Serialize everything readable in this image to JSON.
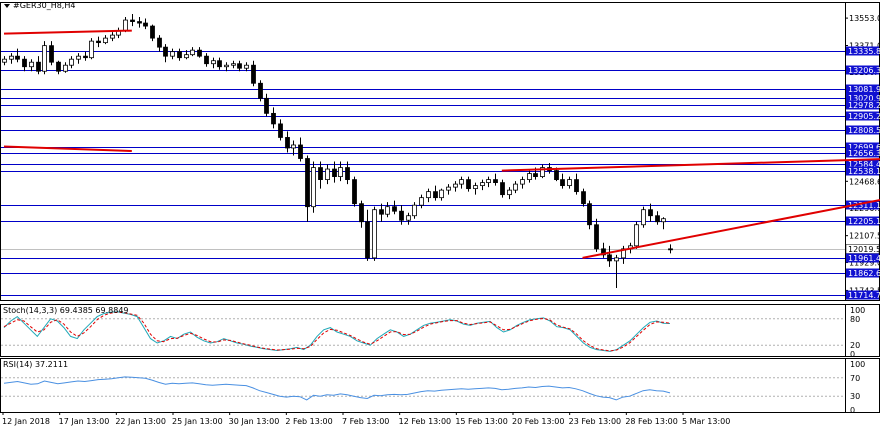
{
  "chart_title": "#GER30_H8,H4",
  "colors": {
    "level_line": "#0000c8",
    "trend_line": "#e00000",
    "label_bg": "#1010d0",
    "stoch_main": "#1fa8b8",
    "stoch_signal": "#e00000",
    "rsi": "#4a90e2"
  },
  "price_axis": {
    "ticks": [
      "13553.0",
      "13371.0",
      "13196.4",
      "12971.2",
      "12809.7",
      "12647.2",
      "12468.6",
      "12290.1",
      "12107.5",
      "11929.0",
      "11743.5"
    ],
    "range": [
      11680,
      13660
    ]
  },
  "levels": [
    "13335.8",
    "13206.3",
    "13081.9",
    "13020.9",
    "12978.2",
    "12905.2",
    "12808.5",
    "12699.6",
    "12656.3",
    "12584.4",
    "12538.1",
    "12311.1",
    "12205.1",
    "12019.5",
    "11961.4",
    "11862.6",
    "11714.7"
  ],
  "current_price": "12019.5",
  "chart_data": {
    "type": "candlestick",
    "x_labels": [
      "12 Jan 2018",
      "17 Jan 13:00",
      "22 Jan 13:00",
      "25 Jan 13:00",
      "30 Jan 13:00",
      "2 Feb 13:00",
      "7 Feb 13:00",
      "12 Feb 13:00",
      "15 Feb 13:00",
      "20 Feb 13:00",
      "23 Feb 13:00",
      "28 Feb 13:00",
      "5 Mar 13:00"
    ],
    "ohlc": [
      [
        13260,
        13300,
        13240,
        13280
      ],
      [
        13280,
        13320,
        13250,
        13300
      ],
      [
        13300,
        13350,
        13260,
        13280
      ],
      [
        13280,
        13300,
        13200,
        13230
      ],
      [
        13230,
        13280,
        13200,
        13260
      ],
      [
        13260,
        13300,
        13180,
        13200
      ],
      [
        13200,
        13400,
        13180,
        13370
      ],
      [
        13370,
        13400,
        13240,
        13260
      ],
      [
        13260,
        13270,
        13180,
        13200
      ],
      [
        13200,
        13260,
        13190,
        13240
      ],
      [
        13240,
        13300,
        13220,
        13280
      ],
      [
        13280,
        13320,
        13250,
        13300
      ],
      [
        13300,
        13330,
        13270,
        13290
      ],
      [
        13290,
        13420,
        13280,
        13400
      ],
      [
        13400,
        13430,
        13360,
        13390
      ],
      [
        13390,
        13440,
        13380,
        13420
      ],
      [
        13420,
        13460,
        13400,
        13440
      ],
      [
        13440,
        13490,
        13420,
        13470
      ],
      [
        13470,
        13560,
        13460,
        13540
      ],
      [
        13540,
        13580,
        13500,
        13530
      ],
      [
        13530,
        13560,
        13490,
        13520
      ],
      [
        13520,
        13550,
        13480,
        13500
      ],
      [
        13500,
        13510,
        13400,
        13420
      ],
      [
        13420,
        13440,
        13330,
        13360
      ],
      [
        13360,
        13380,
        13260,
        13300
      ],
      [
        13300,
        13350,
        13280,
        13330
      ],
      [
        13330,
        13350,
        13270,
        13290
      ],
      [
        13290,
        13340,
        13280,
        13310
      ],
      [
        13310,
        13360,
        13300,
        13340
      ],
      [
        13340,
        13360,
        13290,
        13300
      ],
      [
        13300,
        13320,
        13230,
        13250
      ],
      [
        13250,
        13290,
        13220,
        13270
      ],
      [
        13270,
        13290,
        13210,
        13230
      ],
      [
        13230,
        13260,
        13200,
        13240
      ],
      [
        13240,
        13270,
        13220,
        13250
      ],
      [
        13250,
        13270,
        13200,
        13220
      ],
      [
        13220,
        13260,
        13200,
        13240
      ],
      [
        13240,
        13270,
        13100,
        13120
      ],
      [
        13120,
        13140,
        13000,
        13020
      ],
      [
        13020,
        13050,
        12900,
        12920
      ],
      [
        12920,
        12960,
        12820,
        12850
      ],
      [
        12850,
        12880,
        12740,
        12760
      ],
      [
        12760,
        12800,
        12660,
        12690
      ],
      [
        12690,
        12740,
        12640,
        12710
      ],
      [
        12710,
        12760,
        12600,
        12620
      ],
      [
        12620,
        12640,
        12200,
        12300
      ],
      [
        12300,
        12600,
        12260,
        12560
      ],
      [
        12560,
        12600,
        12420,
        12480
      ],
      [
        12480,
        12580,
        12450,
        12550
      ],
      [
        12550,
        12600,
        12460,
        12500
      ],
      [
        12500,
        12600,
        12470,
        12560
      ],
      [
        12560,
        12600,
        12450,
        12480
      ],
      [
        12480,
        12500,
        12300,
        12320
      ],
      [
        12320,
        12340,
        12160,
        12200
      ],
      [
        12200,
        12280,
        11940,
        11960
      ],
      [
        11960,
        12300,
        11940,
        12280
      ],
      [
        12280,
        12320,
        12200,
        12250
      ],
      [
        12250,
        12330,
        12230,
        12300
      ],
      [
        12300,
        12340,
        12250,
        12270
      ],
      [
        12270,
        12310,
        12180,
        12210
      ],
      [
        12210,
        12260,
        12180,
        12240
      ],
      [
        12240,
        12330,
        12220,
        12310
      ],
      [
        12310,
        12380,
        12290,
        12360
      ],
      [
        12360,
        12420,
        12330,
        12400
      ],
      [
        12400,
        12440,
        12340,
        12360
      ],
      [
        12360,
        12420,
        12340,
        12410
      ],
      [
        12410,
        12450,
        12380,
        12430
      ],
      [
        12430,
        12470,
        12400,
        12450
      ],
      [
        12450,
        12500,
        12420,
        12480
      ],
      [
        12480,
        12500,
        12400,
        12420
      ],
      [
        12420,
        12460,
        12380,
        12440
      ],
      [
        12440,
        12480,
        12410,
        12460
      ],
      [
        12460,
        12500,
        12430,
        12480
      ],
      [
        12480,
        12520,
        12440,
        12460
      ],
      [
        12460,
        12480,
        12360,
        12380
      ],
      [
        12380,
        12430,
        12350,
        12410
      ],
      [
        12410,
        12470,
        12390,
        12450
      ],
      [
        12450,
        12500,
        12420,
        12480
      ],
      [
        12480,
        12540,
        12460,
        12520
      ],
      [
        12520,
        12560,
        12480,
        12500
      ],
      [
        12500,
        12580,
        12490,
        12560
      ],
      [
        12560,
        12590,
        12520,
        12540
      ],
      [
        12540,
        12560,
        12470,
        12480
      ],
      [
        12480,
        12520,
        12420,
        12440
      ],
      [
        12440,
        12500,
        12420,
        12480
      ],
      [
        12480,
        12520,
        12380,
        12400
      ],
      [
        12400,
        12420,
        12300,
        12320
      ],
      [
        12320,
        12340,
        12150,
        12180
      ],
      [
        12180,
        12220,
        12000,
        12020
      ],
      [
        12020,
        12060,
        11960,
        11980
      ],
      [
        11980,
        12040,
        11900,
        11940
      ],
      [
        11940,
        11980,
        11760,
        11960
      ],
      [
        11960,
        12040,
        11920,
        12020
      ],
      [
        12020,
        12060,
        11990,
        12040
      ],
      [
        12040,
        12200,
        12020,
        12180
      ],
      [
        12180,
        12300,
        12160,
        12280
      ],
      [
        12280,
        12320,
        12200,
        12240
      ],
      [
        12240,
        12270,
        12180,
        12200
      ],
      [
        12200,
        12230,
        12150,
        12220
      ],
      [
        12020,
        12050,
        11990,
        12019.5
      ]
    ],
    "trend_lines": [
      {
        "from": [
          0,
          13450
        ],
        "to": [
          19,
          13470
        ]
      },
      {
        "from": [
          0,
          12700
        ],
        "to": [
          19,
          12670
        ]
      },
      {
        "from": [
          74,
          12540
        ],
        "to": [
          148,
          12640
        ]
      },
      {
        "from": [
          86,
          11960
        ],
        "to": [
          155,
          12560
        ]
      }
    ],
    "stochastic": {
      "label": "Stoch(14,3,3) 69.4385 69.8849",
      "levels": [
        "100",
        "80",
        "20",
        "0"
      ],
      "main": [
        60,
        75,
        85,
        70,
        55,
        40,
        60,
        80,
        75,
        60,
        40,
        35,
        55,
        70,
        85,
        92,
        95,
        96,
        93,
        90,
        85,
        60,
        35,
        25,
        30,
        40,
        35,
        45,
        50,
        38,
        30,
        25,
        28,
        35,
        30,
        25,
        22,
        18,
        15,
        12,
        10,
        8,
        10,
        12,
        15,
        10,
        20,
        40,
        55,
        60,
        50,
        45,
        40,
        30,
        25,
        20,
        35,
        45,
        55,
        50,
        40,
        45,
        55,
        65,
        70,
        72,
        75,
        78,
        75,
        68,
        65,
        70,
        72,
        74,
        60,
        50,
        55,
        65,
        72,
        78,
        80,
        82,
        75,
        62,
        60,
        55,
        40,
        25,
        15,
        10,
        8,
        6,
        10,
        20,
        30,
        45,
        60,
        72,
        75,
        70,
        69.4
      ],
      "signal": [
        62,
        70,
        78,
        75,
        62,
        50,
        55,
        72,
        78,
        68,
        50,
        40,
        48,
        62,
        78,
        88,
        93,
        95,
        94,
        91,
        88,
        70,
        45,
        30,
        28,
        35,
        36,
        42,
        47,
        42,
        34,
        28,
        27,
        32,
        31,
        27,
        23,
        20,
        16,
        13,
        11,
        9,
        10,
        11,
        13,
        12,
        17,
        33,
        48,
        56,
        54,
        48,
        42,
        34,
        27,
        22,
        30,
        40,
        50,
        51,
        44,
        45,
        52,
        61,
        68,
        71,
        74,
        76,
        76,
        70,
        67,
        69,
        71,
        73,
        64,
        55,
        56,
        63,
        70,
        76,
        79,
        81,
        77,
        66,
        61,
        57,
        45,
        30,
        19,
        12,
        9,
        7,
        9,
        16,
        26,
        40,
        54,
        67,
        73,
        72,
        69.9
      ]
    },
    "rsi": {
      "label": "RSI(14) 37.2111",
      "levels": [
        "100",
        "70",
        "30",
        "0"
      ],
      "values": [
        58,
        60,
        62,
        59,
        56,
        57,
        63,
        60,
        57,
        59,
        61,
        63,
        62,
        64,
        66,
        67,
        68,
        70,
        72,
        71,
        70,
        69,
        65,
        60,
        56,
        58,
        57,
        58,
        59,
        57,
        55,
        54,
        55,
        56,
        55,
        54,
        53,
        48,
        42,
        38,
        34,
        30,
        28,
        30,
        29,
        22,
        32,
        30,
        33,
        32,
        35,
        33,
        30,
        27,
        25,
        32,
        31,
        33,
        34,
        33,
        34,
        37,
        40,
        42,
        41,
        43,
        44,
        45,
        46,
        45,
        46,
        47,
        48,
        47,
        44,
        45,
        47,
        48,
        50,
        49,
        51,
        52,
        50,
        48,
        49,
        46,
        42,
        36,
        31,
        28,
        27,
        22,
        28,
        30,
        36,
        42,
        44,
        42,
        41,
        37.2
      ]
    }
  }
}
